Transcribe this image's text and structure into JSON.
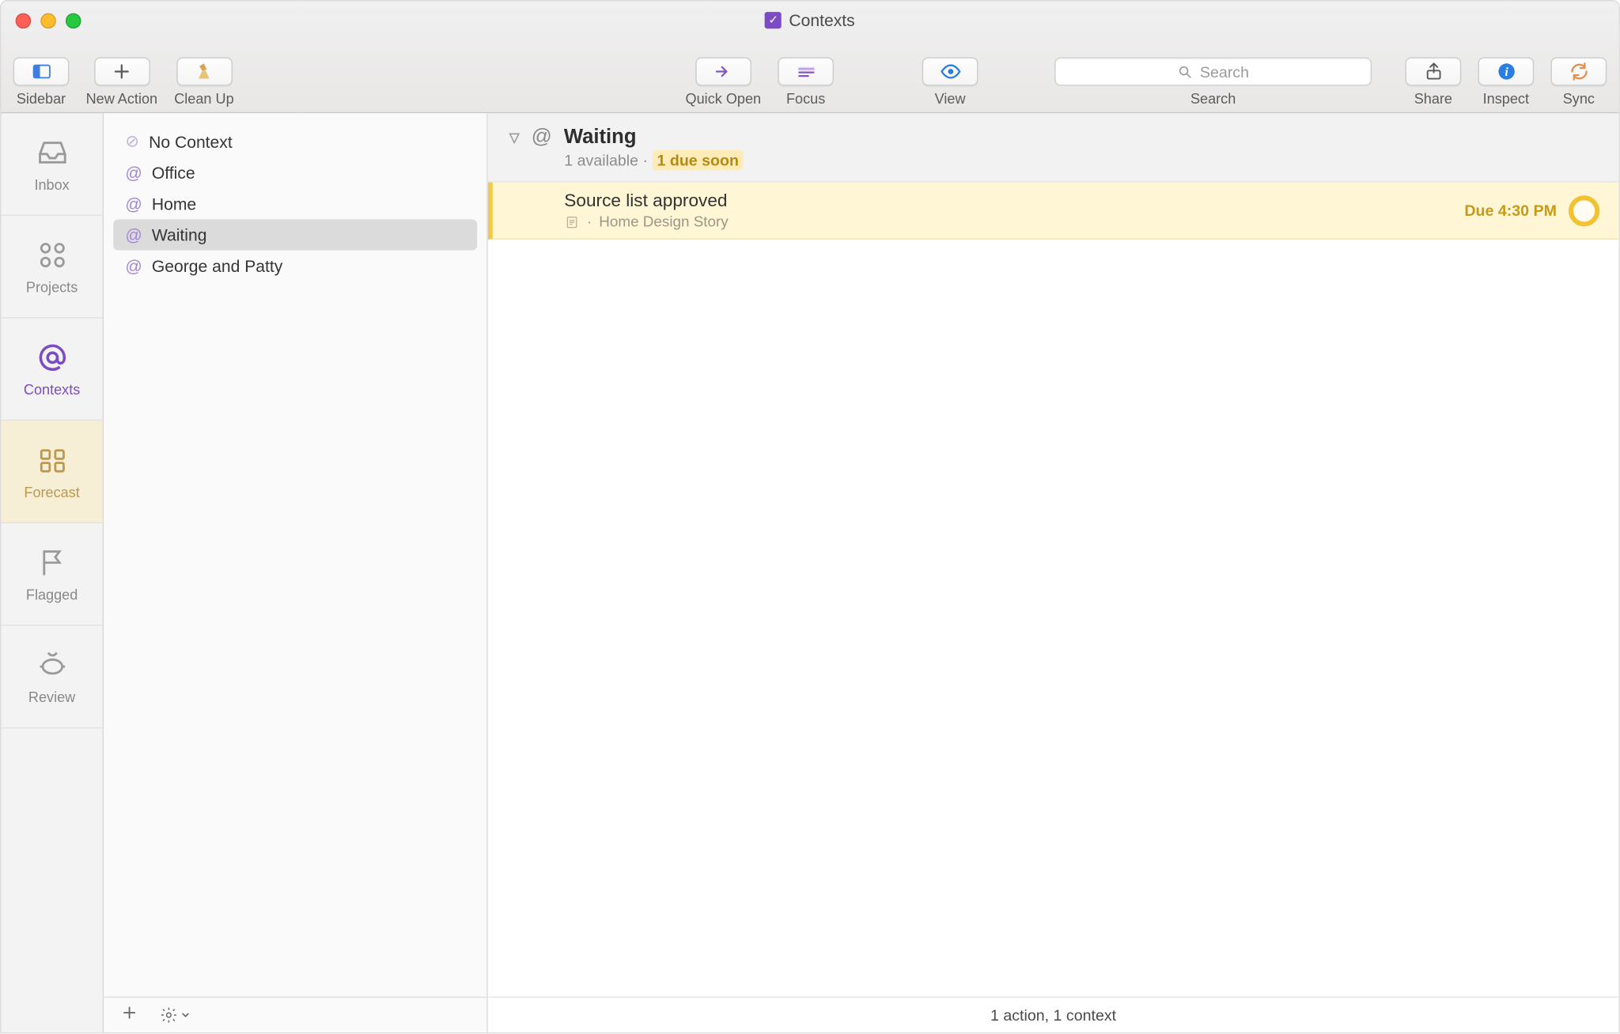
{
  "window": {
    "title": "Contexts"
  },
  "toolbar": {
    "sidebar": "Sidebar",
    "new_action": "New Action",
    "clean_up": "Clean Up",
    "quick_open": "Quick Open",
    "focus": "Focus",
    "view": "View",
    "search_placeholder": "Search",
    "search_label": "Search",
    "share": "Share",
    "inspect": "Inspect",
    "sync": "Sync"
  },
  "perspectives": {
    "inbox": "Inbox",
    "projects": "Projects",
    "contexts": "Contexts",
    "forecast": "Forecast",
    "flagged": "Flagged",
    "review": "Review"
  },
  "contexts": [
    "No Context",
    "Office",
    "Home",
    "Waiting",
    "George and Patty"
  ],
  "selected_context_index": 3,
  "main": {
    "group_title": "Waiting",
    "available_text": "1 available",
    "due_soon_text": "1 due soon",
    "tasks": [
      {
        "title": "Source list approved",
        "project": "Home Design Story",
        "due": "Due 4:30 PM"
      }
    ],
    "status": "1 action, 1 context"
  }
}
